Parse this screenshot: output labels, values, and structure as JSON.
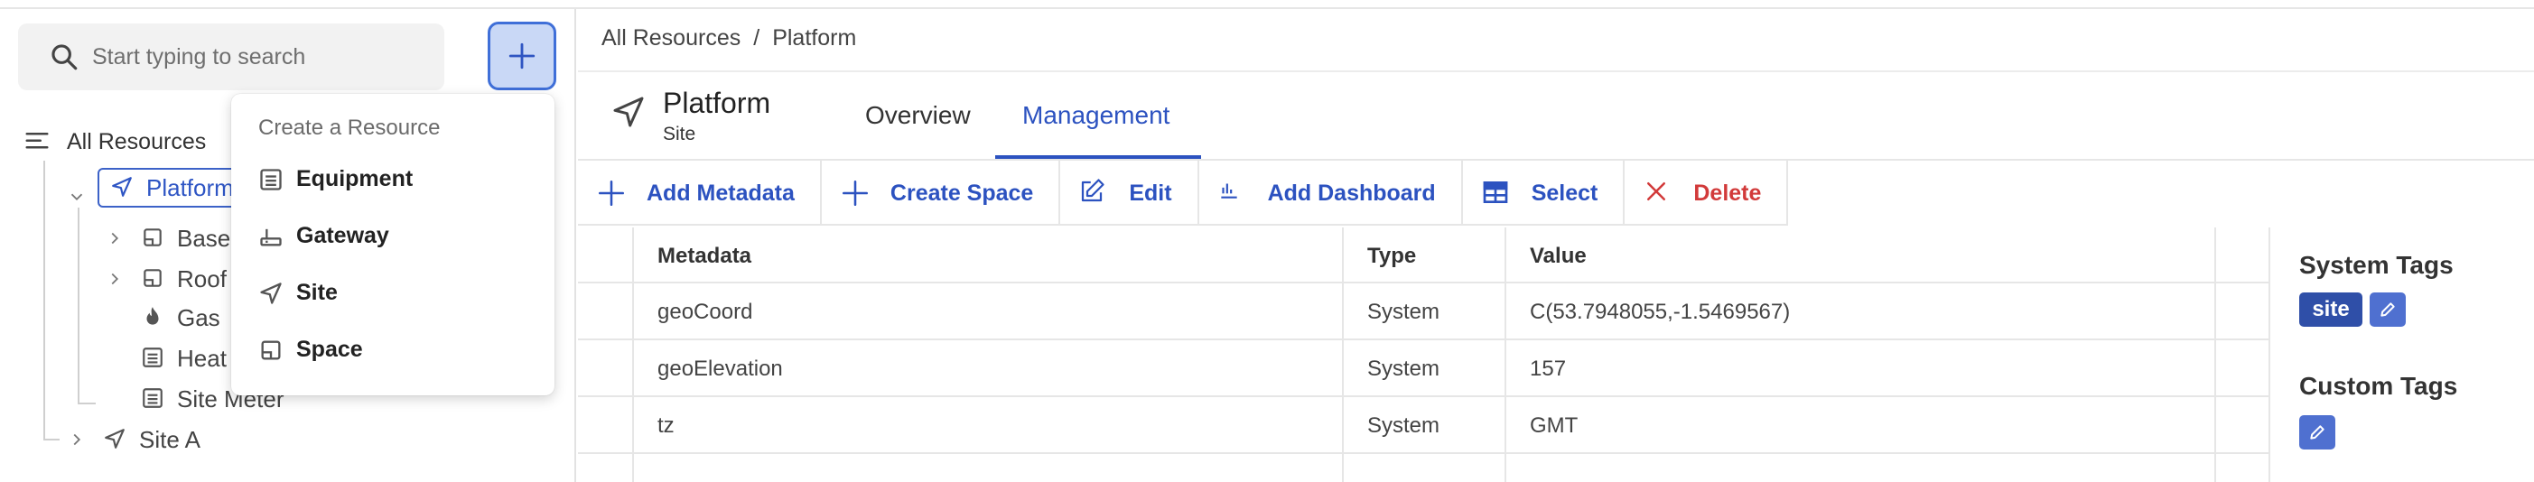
{
  "search": {
    "placeholder": "Start typing to search"
  },
  "tree": {
    "root_label": "All Resources",
    "platform_label": "Platform",
    "children": [
      {
        "label": "Base",
        "icon": "space-icon"
      },
      {
        "label": "Roof",
        "icon": "space-icon"
      },
      {
        "label": "Gas",
        "icon": "flame-icon"
      },
      {
        "label": "Heat",
        "icon": "meter-icon"
      },
      {
        "label": "Site Meter",
        "icon": "meter-icon"
      }
    ],
    "site_a_label": "Site A"
  },
  "dropdown": {
    "title": "Create a Resource",
    "items": [
      {
        "label": "Equipment",
        "icon": "meter-icon"
      },
      {
        "label": "Gateway",
        "icon": "gateway-icon"
      },
      {
        "label": "Site",
        "icon": "navigation-icon"
      },
      {
        "label": "Space",
        "icon": "space-icon"
      }
    ]
  },
  "breadcrumb": {
    "root": "All Resources",
    "sep": "/",
    "current": "Platform"
  },
  "page": {
    "title": "Platform",
    "subtitle": "Site"
  },
  "tabs": [
    {
      "label": "Overview"
    },
    {
      "label": "Management",
      "active": true
    }
  ],
  "toolbar": [
    {
      "label": "Add Metadata",
      "icon": "plus-icon"
    },
    {
      "label": "Create Space",
      "icon": "plus-icon"
    },
    {
      "label": "Edit",
      "icon": "edit-icon"
    },
    {
      "label": "Add Dashboard",
      "icon": "bar-chart-icon"
    },
    {
      "label": "Select",
      "icon": "grid-icon"
    },
    {
      "label": "Delete",
      "icon": "close-icon",
      "danger": true
    }
  ],
  "table": {
    "headers": {
      "metadata": "Metadata",
      "type": "Type",
      "value": "Value"
    },
    "rows": [
      {
        "metadata": "geoCoord",
        "type": "System",
        "value": "C(53.7948055,-1.5469567)"
      },
      {
        "metadata": "geoElevation",
        "type": "System",
        "value": "157"
      },
      {
        "metadata": "tz",
        "type": "System",
        "value": "GMT"
      }
    ]
  },
  "right_panel": {
    "system_tags_title": "System Tags",
    "system_tags": [
      "site"
    ],
    "custom_tags_title": "Custom Tags"
  },
  "colors": {
    "accent": "#2c52c0",
    "danger": "#d23a3a",
    "tag": "#2f4fa8"
  }
}
